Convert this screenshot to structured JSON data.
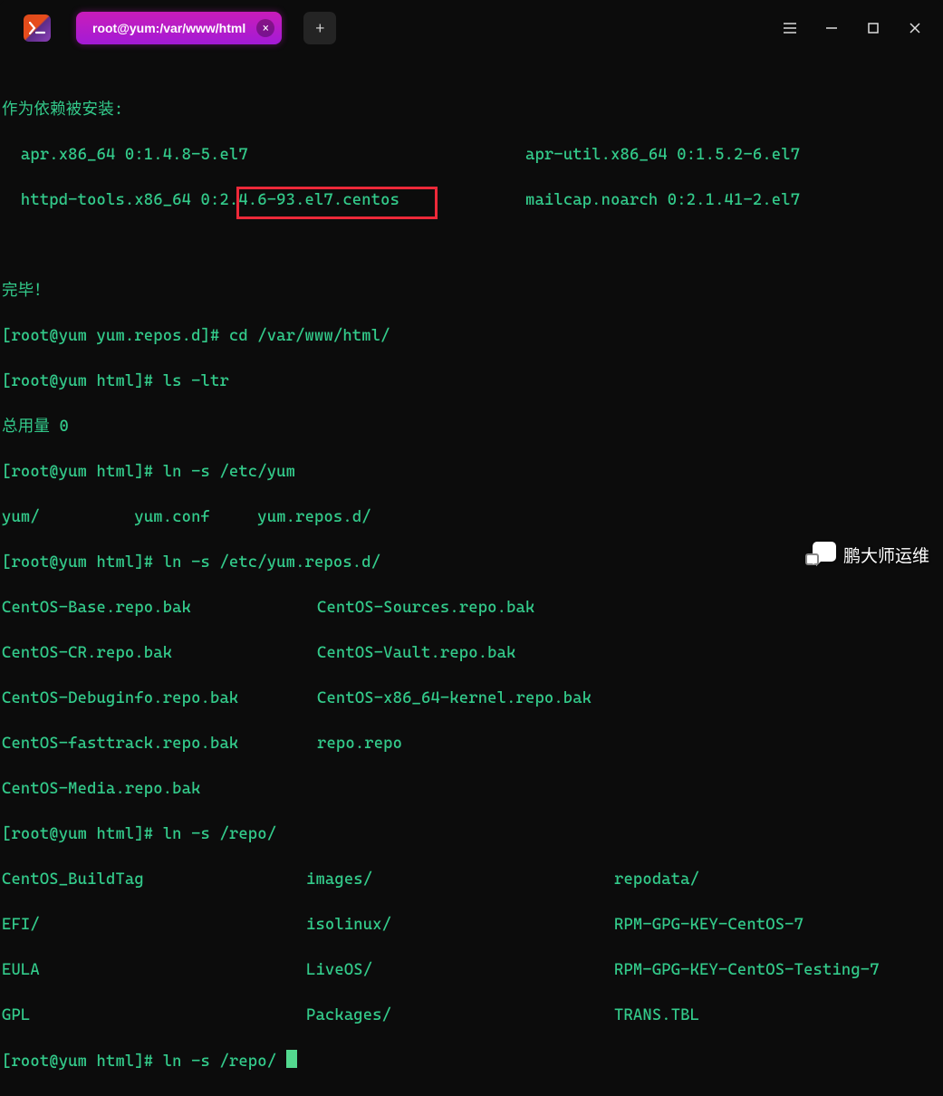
{
  "titlebar": {
    "tab_title": "root@yum:/var/www/html",
    "close_glyph": "×",
    "plus_glyph": "+"
  },
  "term": {
    "header": "作为依赖被安装:",
    "pkg1": "  apr.x86_64 0:1.4.8-5.el7",
    "pkg2": "apr-util.x86_64 0:1.5.2-6.el7",
    "pkg3": "  httpd-tools.x86_64 0:2.4.6-93.el7.centos",
    "pkg4": "mailcap.noarch 0:2.1.41-2.el7",
    "done": "完毕！",
    "p1_prompt": "[root@yum yum.repos.d]# ",
    "p1_cmd": "cd /var/www/html/",
    "p2_prompt": "[root@yum html]# ",
    "p2_cmd": "ls -ltr",
    "total": "总用量 0",
    "p3_cmd": "ln -s /etc/yum",
    "yumtab1": "yum/",
    "yumtab2": "yum.conf",
    "yumtab3": "yum.repos.d/",
    "p4_cmd": "ln -s /etc/yum.repos.d/",
    "r1a": "CentOS-Base.repo.bak",
    "r1b": "CentOS-Sources.repo.bak",
    "r2a": "CentOS-CR.repo.bak",
    "r2b": "CentOS-Vault.repo.bak",
    "r3a": "CentOS-Debuginfo.repo.bak",
    "r3b": "CentOS-x86_64-kernel.repo.bak",
    "r4a": "CentOS-fasttrack.repo.bak",
    "r4b": "repo.repo",
    "r5a": "CentOS-Media.repo.bak",
    "p5_cmd": "ln -s /repo/",
    "f1a": "CentOS_BuildTag",
    "f1b": "images/",
    "f1c": "repodata/",
    "f2a": "EFI/",
    "f2b": "isolinux/",
    "f2c": "RPM-GPG-KEY-CentOS-7",
    "f3a": "EULA",
    "f3b": "LiveOS/",
    "f3c": "RPM-GPG-KEY-CentOS-Testing-7",
    "f4a": "GPL",
    "f4b": "Packages/",
    "f4c": "TRANS.TBL",
    "p6_cmd": "ln -s /repo/ "
  },
  "watermark": {
    "text": "鹏大师运维"
  }
}
